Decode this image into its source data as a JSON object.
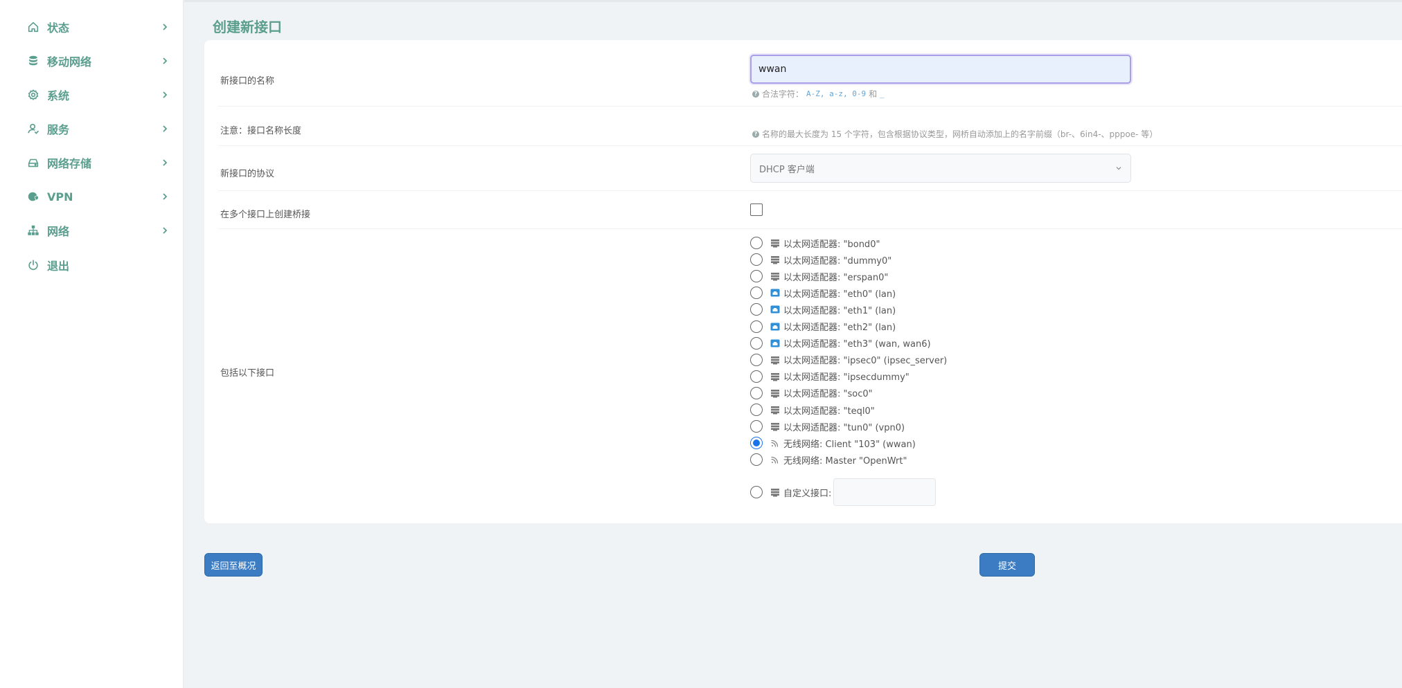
{
  "sidebar": {
    "items": [
      {
        "label": "状态",
        "icon": "home-icon"
      },
      {
        "label": "移动网络",
        "icon": "database-icon"
      },
      {
        "label": "系统",
        "icon": "gear-icon"
      },
      {
        "label": "服务",
        "icon": "user-icon"
      },
      {
        "label": "网络存储",
        "icon": "drive-icon"
      },
      {
        "label": "VPN",
        "icon": "vpn-shield-icon"
      },
      {
        "label": "网络",
        "icon": "network-tree-icon"
      },
      {
        "label": "退出",
        "icon": "power-icon"
      }
    ]
  },
  "page": {
    "title": "创建新接口"
  },
  "form": {
    "name_label": "新接口的名称",
    "name_value": "wwan",
    "name_hint_prefix": "合法字符：",
    "name_hint_codes": "A-Z, a-z, 0-9",
    "name_hint_and": "和",
    "name_hint_underscore": "_",
    "note_label": "注意：接口名称长度",
    "note_hint": "名称的最大长度为 15 个字符，包含根据协议类型，网桥自动添加上的名字前缀（br-、6in4-、pppoe- 等）",
    "protocol_label": "新接口的协议",
    "protocol_value": "DHCP 客户端",
    "bridge_label": "在多个接口上创建桥接",
    "include_label": "包括以下接口",
    "interfaces": [
      {
        "text": "以太网适配器: \"bond0\"",
        "icon": "ethernet-icon",
        "checked": false
      },
      {
        "text": "以太网适配器: \"dummy0\"",
        "icon": "ethernet-icon",
        "checked": false
      },
      {
        "text": "以太网适配器: \"erspan0\"",
        "icon": "ethernet-icon",
        "checked": false
      },
      {
        "text": "以太网适配器: \"eth0\" (lan)",
        "icon": "ethernet-port-icon",
        "checked": false
      },
      {
        "text": "以太网适配器: \"eth1\" (lan)",
        "icon": "ethernet-port-icon",
        "checked": false
      },
      {
        "text": "以太网适配器: \"eth2\" (lan)",
        "icon": "ethernet-port-icon",
        "checked": false
      },
      {
        "text": "以太网适配器: \"eth3\" (wan, wan6)",
        "icon": "ethernet-port-icon",
        "checked": false
      },
      {
        "text": "以太网适配器: \"ipsec0\" (ipsec_server)",
        "icon": "ethernet-icon",
        "checked": false
      },
      {
        "text": "以太网适配器: \"ipsecdummy\"",
        "icon": "ethernet-icon",
        "checked": false
      },
      {
        "text": "以太网适配器: \"soc0\"",
        "icon": "ethernet-icon",
        "checked": false
      },
      {
        "text": "以太网适配器: \"teql0\"",
        "icon": "ethernet-icon",
        "checked": false
      },
      {
        "text": "以太网适配器: \"tun0\" (vpn0)",
        "icon": "ethernet-icon",
        "checked": false
      },
      {
        "text": "无线网络: Client \"103\" (wwan)",
        "icon": "wifi-icon",
        "checked": true
      },
      {
        "text": "无线网络: Master \"OpenWrt\"",
        "icon": "wifi-icon",
        "checked": false
      }
    ],
    "custom_label": "自定义接口:"
  },
  "buttons": {
    "back": "返回至概况",
    "submit": "提交"
  },
  "colors": {
    "accent": "#5a9e8d",
    "button": "#3b7cc2",
    "radio_checked": "#1a73e8"
  }
}
